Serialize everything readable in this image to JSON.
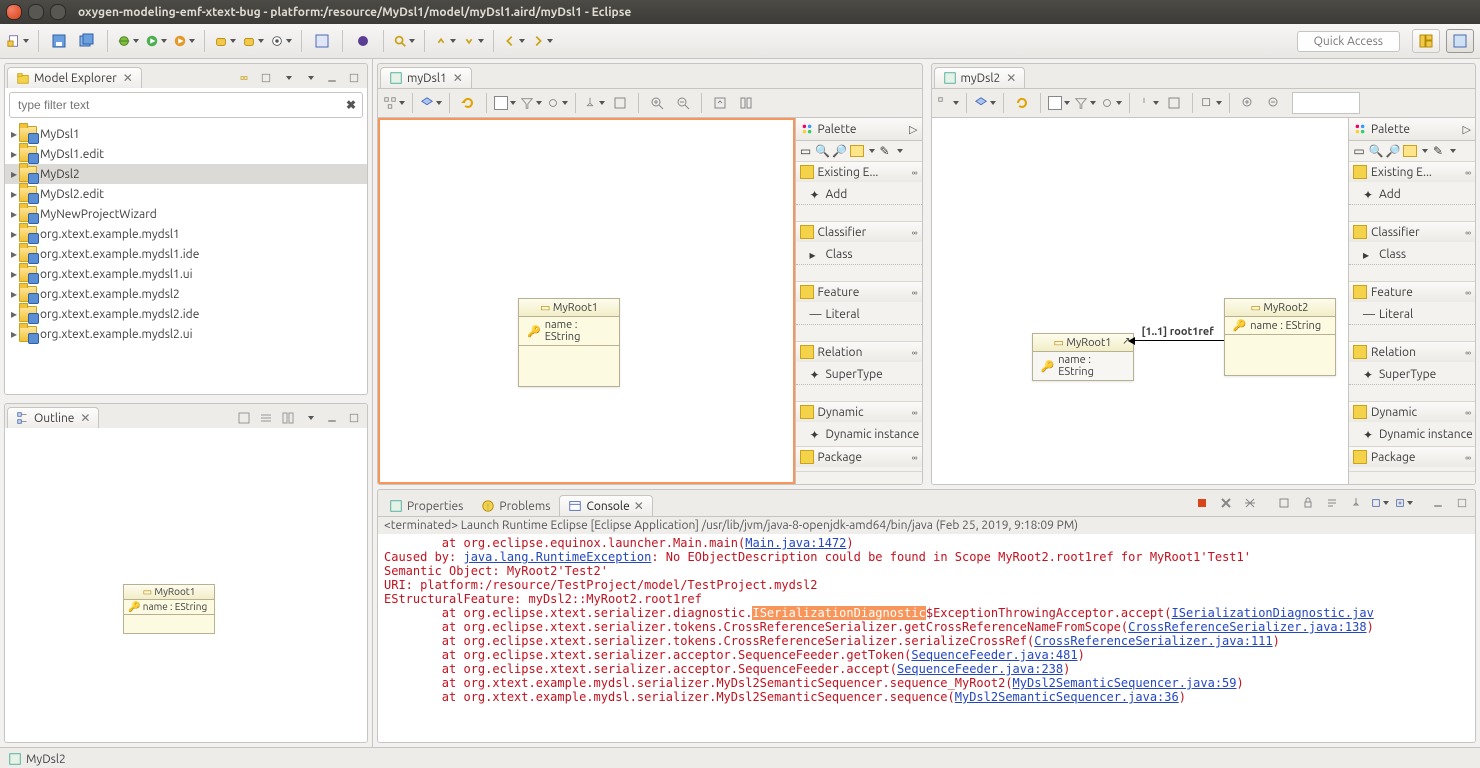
{
  "window": {
    "title": "oxygen-modeling-emf-xtext-bug - platform:/resource/MyDsl1/model/myDsl1.aird/myDsl1 - Eclipse"
  },
  "toolbar": {
    "quick_access": "Quick Access"
  },
  "model_explorer": {
    "title": "Model Explorer",
    "filter_placeholder": "type filter text",
    "items": [
      "MyDsl1",
      "MyDsl1.edit",
      "MyDsl2",
      "MyDsl2.edit",
      "MyNewProjectWizard",
      "org.xtext.example.mydsl1",
      "org.xtext.example.mydsl1.ide",
      "org.xtext.example.mydsl1.ui",
      "org.xtext.example.mydsl2",
      "org.xtext.example.mydsl2.ide",
      "org.xtext.example.mydsl2.ui"
    ],
    "selected_index": 2
  },
  "outline": {
    "title": "Outline",
    "class_name": "MyRoot1",
    "attr": "name : EString"
  },
  "editors": {
    "left": {
      "tab": "myDsl1",
      "class": {
        "name": "MyRoot1",
        "attr": "name : EString"
      }
    },
    "right": {
      "tab": "myDsl2",
      "class": {
        "name": "MyRoot2",
        "attr": "name : EString"
      },
      "shortcut": {
        "name": "MyRoot1",
        "attr": "name : EString"
      },
      "ref_label": "[1..1] root1ref"
    }
  },
  "palette": {
    "title": "Palette",
    "group_existing": "Existing E...",
    "entry_add": "Add",
    "group_classifier": "Classifier",
    "entry_class": "Class",
    "group_feature": "Feature",
    "entry_literal": "Literal",
    "group_relation": "Relation",
    "entry_supertype": "SuperType",
    "group_dynamic": "Dynamic",
    "entry_dynamic_instance": "Dynamic instance",
    "group_package": "Package"
  },
  "bottom": {
    "tab_properties": "Properties",
    "tab_problems": "Problems",
    "tab_console": "Console",
    "console_desc": "<terminated> Launch Runtime Eclipse [Eclipse Application] /usr/lib/jvm/java-8-openjdk-amd64/bin/java (Feb 25, 2019, 9:18:09 PM)",
    "lines": {
      "l0a": "        at org.eclipse.equinox.launcher.Main.main(",
      "l0b": "Main.java:1472",
      "l0c": ")",
      "l1a": "Caused by: ",
      "l1b": "java.lang.RuntimeException",
      "l1c": ": No EObjectDescription could be found in Scope MyRoot2.root1ref for MyRoot1'Test1'",
      "l2": "Semantic Object: MyRoot2'Test2'",
      "l3": "URI: platform:/resource/TestProject/model/TestProject.mydsl2",
      "l4": "EStructuralFeature: myDsl2::MyRoot2.root1ref",
      "l5a": "        at org.eclipse.xtext.serializer.diagnostic.",
      "l5h": "ISerializationDiagnostic",
      "l5b": "$ExceptionThrowingAcceptor.accept(",
      "l5c": "ISerializationDiagnostic.jav",
      "l6a": "        at org.eclipse.xtext.serializer.tokens.CrossReferenceSerializer.getCrossReferenceNameFromScope(",
      "l6b": "CrossReferenceSerializer.java:138",
      "l6c": ")",
      "l7a": "        at org.eclipse.xtext.serializer.tokens.CrossReferenceSerializer.serializeCrossRef(",
      "l7b": "CrossReferenceSerializer.java:111",
      "l7c": ")",
      "l8a": "        at org.eclipse.xtext.serializer.acceptor.SequenceFeeder.getToken(",
      "l8b": "SequenceFeeder.java:481",
      "l8c": ")",
      "l9a": "        at org.eclipse.xtext.serializer.acceptor.SequenceFeeder.accept(",
      "l9b": "SequenceFeeder.java:238",
      "l9c": ")",
      "l10a": "        at org.xtext.example.mydsl.serializer.MyDsl2SemanticSequencer.sequence_MyRoot2(",
      "l10b": "MyDsl2SemanticSequencer.java:59",
      "l10c": ")",
      "l11a": "        at org.xtext.example.mydsl.serializer.MyDsl2SemanticSequencer.sequence(",
      "l11b": "MyDsl2SemanticSequencer.java:36",
      "l11c": ")"
    }
  },
  "status": {
    "text": "MyDsl2"
  }
}
